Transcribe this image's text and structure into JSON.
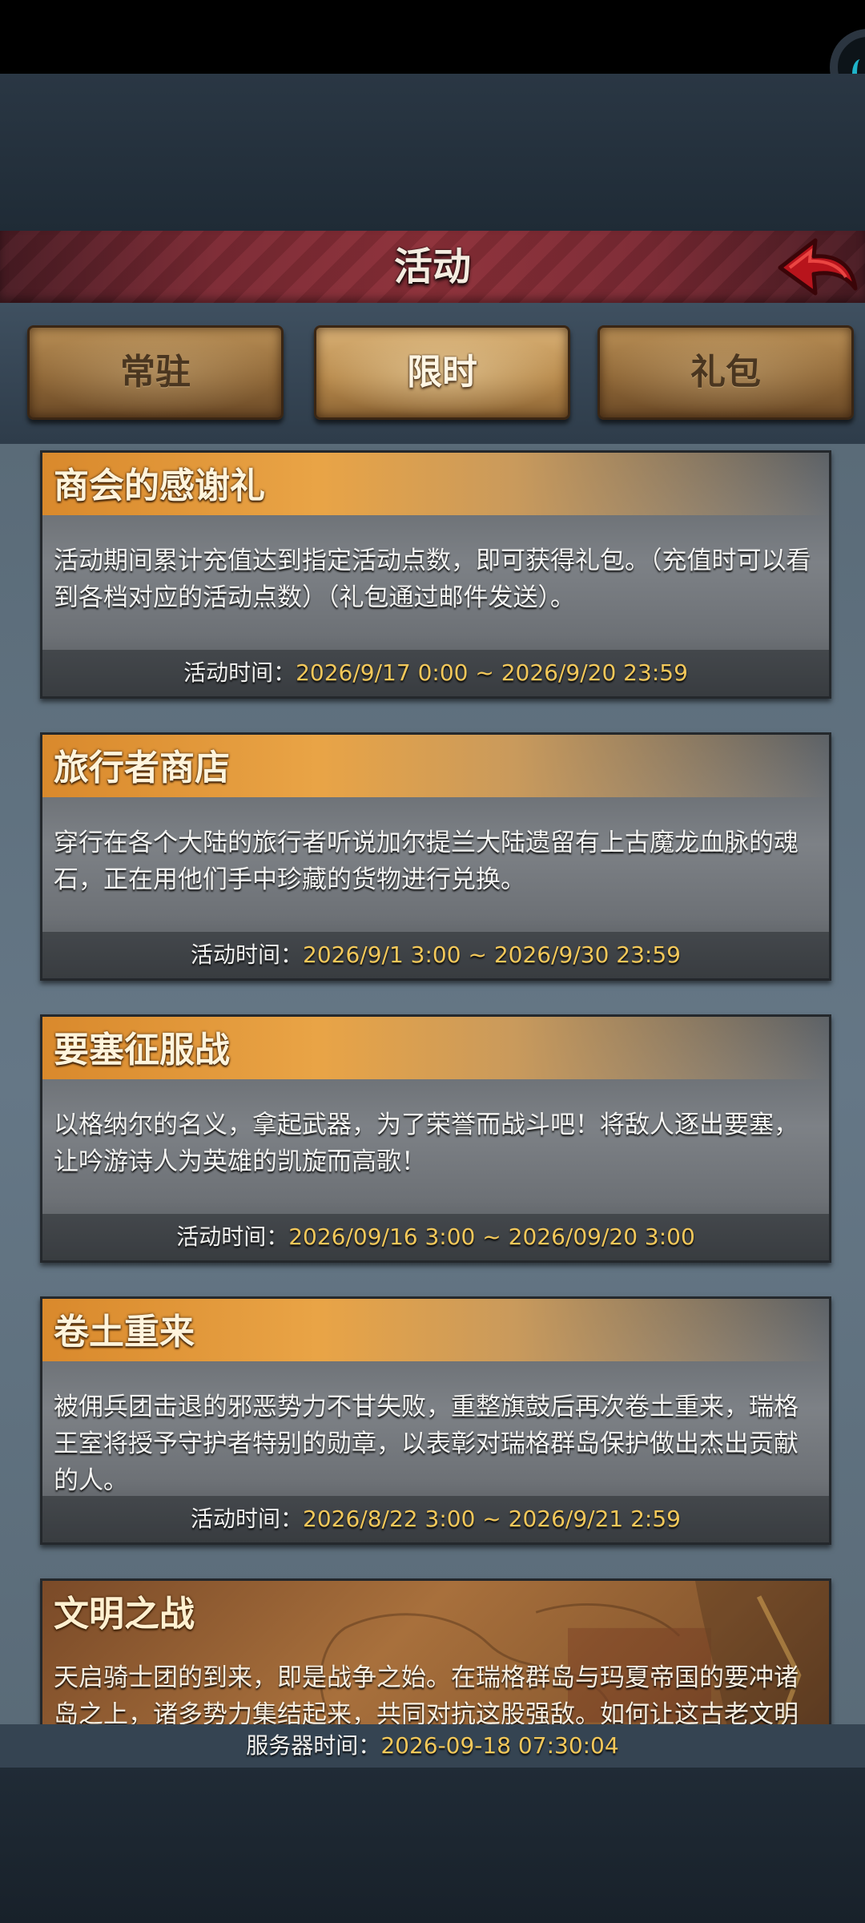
{
  "header": {
    "title": "活动"
  },
  "tabs": [
    {
      "label": "常驻",
      "active": false
    },
    {
      "label": "限时",
      "active": true
    },
    {
      "label": "礼包",
      "active": false
    }
  ],
  "events": [
    {
      "title": "商会的感谢礼",
      "description": "活动期间累计充值达到指定活动点数，即可获得礼包。（充值时可以看到各档对应的活动点数）（礼包通过邮件发送）。",
      "time_label": "活动时间：",
      "time_value": "2026/9/17 0:00 ~ 2026/9/20 23:59"
    },
    {
      "title": "旅行者商店",
      "description": "穿行在各个大陆的旅行者听说加尔提兰大陆遗留有上古魔龙血脉的魂石，正在用他们手中珍藏的货物进行兑换。",
      "time_label": "活动时间：",
      "time_value": "2026/9/1 3:00 ~ 2026/9/30 23:59"
    },
    {
      "title": "要塞征服战",
      "description": "以格纳尔的名义，拿起武器，为了荣誉而战斗吧！将敌人逐出要塞，让吟游诗人为英雄的凯旋而高歌！",
      "time_label": "活动时间：",
      "time_value": "2026/09/16 3:00 ~ 2026/09/20 3:00"
    },
    {
      "title": "卷土重来",
      "description": "被佣兵团击退的邪恶势力不甘失败，重整旗鼓后再次卷土重来，瑞格王室将授予守护者特别的勋章，以表彰对瑞格群岛保护做出杰出贡献的人。",
      "time_label": "活动时间：",
      "time_value": "2026/8/22 3:00 ~ 2026/9/21 2:59"
    },
    {
      "title": "文明之战",
      "description": "天启骑士团的到来，即是战争之始。在瑞格群岛与玛夏帝国的要冲诸岛之上，诸多势力集结起来，共同对抗这股强敌。如何让这古老文明得以"
    }
  ],
  "server_time": {
    "label": "服务器时间：",
    "value": "2026-09-18 07:30:04"
  },
  "colors": {
    "accent_gold": "#f3c85a",
    "header_red": "#8e3039",
    "title_orange": "#e9a446"
  },
  "icons": {
    "back": "red-back-arrow-icon"
  }
}
